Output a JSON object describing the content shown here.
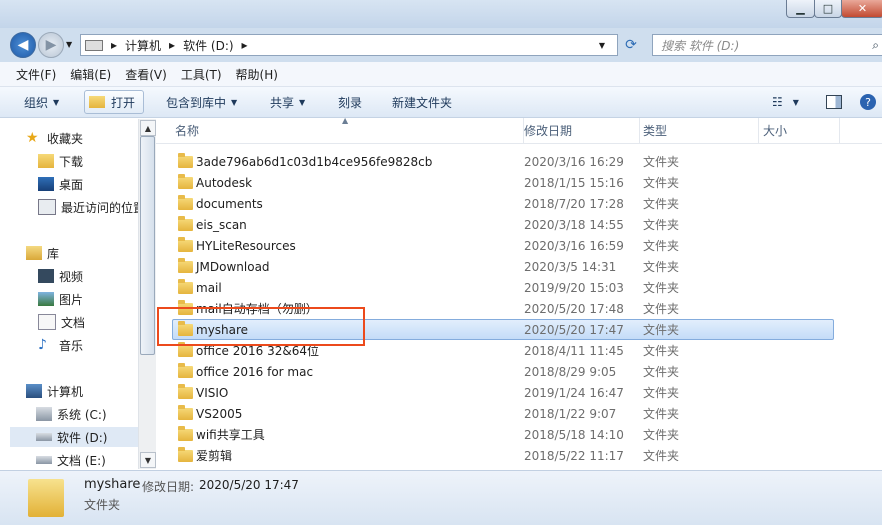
{
  "title_bar": {
    "minimize": "▁",
    "maximize": "□",
    "close": "✕"
  },
  "address": {
    "segments": [
      "▸",
      "计算机",
      "▸",
      "软件 (D:)",
      "▸"
    ],
    "search_placeholder": "搜索 软件 (D:)"
  },
  "menu": [
    "文件(F)",
    "编辑(E)",
    "查看(V)",
    "工具(T)",
    "帮助(H)"
  ],
  "toolbar": {
    "organize": "组织",
    "open": "打开",
    "include_library": "包含到库中",
    "share": "共享",
    "burn": "刻录",
    "new_folder": "新建文件夹"
  },
  "nav": {
    "favorites": {
      "label": "收藏夹",
      "items": [
        "下载",
        "桌面",
        "最近访问的位置"
      ]
    },
    "libraries": {
      "label": "库",
      "items": [
        "视频",
        "图片",
        "文档",
        "音乐"
      ]
    },
    "computer": {
      "label": "计算机",
      "drives": [
        "系统 (C:)",
        "软件 (D:)",
        "文档 (E:)"
      ]
    }
  },
  "columns": {
    "name": "名称",
    "modified": "修改日期",
    "type": "类型",
    "size": "大小"
  },
  "files": [
    {
      "name": "3ade796ab6d1c03d1b4ce956fe9828cb",
      "date": "2020/3/16 16:29",
      "type": "文件夹"
    },
    {
      "name": "Autodesk",
      "date": "2018/1/15 15:16",
      "type": "文件夹"
    },
    {
      "name": "documents",
      "date": "2018/7/20 17:28",
      "type": "文件夹"
    },
    {
      "name": "eis_scan",
      "date": "2020/3/18 14:55",
      "type": "文件夹"
    },
    {
      "name": "HYLiteResources",
      "date": "2020/3/16 16:59",
      "type": "文件夹"
    },
    {
      "name": "JMDownload",
      "date": "2020/3/5 14:31",
      "type": "文件夹"
    },
    {
      "name": "mail",
      "date": "2019/9/20 15:03",
      "type": "文件夹"
    },
    {
      "name": "mail自动存档（勿删）",
      "date": "2020/5/20 17:48",
      "type": "文件夹"
    },
    {
      "name": "myshare",
      "date": "2020/5/20 17:47",
      "type": "文件夹"
    },
    {
      "name": "office 2016 32&64位",
      "date": "2018/4/11 11:45",
      "type": "文件夹"
    },
    {
      "name": "office 2016 for mac",
      "date": "2018/8/29 9:05",
      "type": "文件夹"
    },
    {
      "name": "VISIO",
      "date": "2019/1/24 16:47",
      "type": "文件夹"
    },
    {
      "name": "VS2005",
      "date": "2018/1/22 9:07",
      "type": "文件夹"
    },
    {
      "name": "wifi共享工具",
      "date": "2018/5/18 14:10",
      "type": "文件夹"
    },
    {
      "name": "爱剪辑",
      "date": "2018/5/22 11:17",
      "type": "文件夹"
    }
  ],
  "selected_index": 8,
  "details": {
    "name": "myshare",
    "modified_label": "修改日期:",
    "modified": "2020/5/20 17:47",
    "type": "文件夹"
  }
}
